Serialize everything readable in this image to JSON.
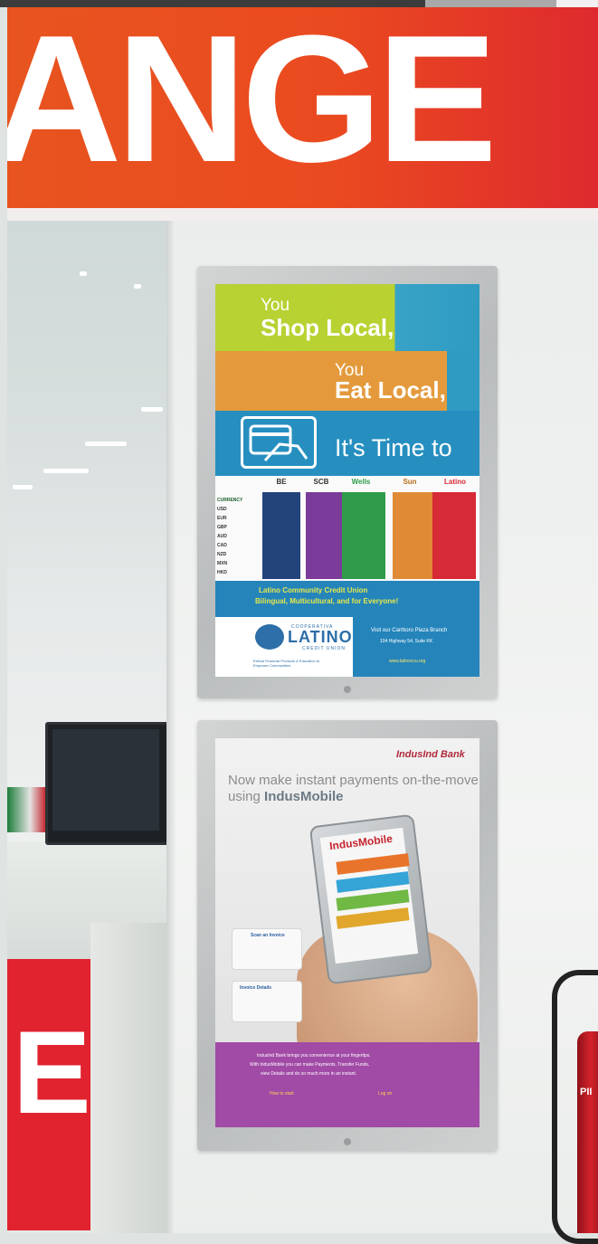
{
  "banner": {
    "text": "ANGE"
  },
  "store": {
    "sign_letter": "E"
  },
  "poster_top": {
    "line1": "You",
    "line2": "Shop Local,",
    "line3": "You",
    "line4": "Eat Local,",
    "line5": "It's Time to",
    "currency_header": "CURRENCY",
    "currencies": [
      "USD",
      "EUR",
      "GBP",
      "AUD",
      "CAD",
      "NZD",
      "MXN",
      "HKD"
    ],
    "logos": [
      "BE",
      "SCB",
      "Wells",
      "Sun",
      "Latino"
    ],
    "tagline1": "Latino Community Credit Union",
    "tagline2": "Bilingual, Multicultural, and for Everyone!",
    "logo": "LATINO",
    "logo_top": "COOPERATIVA",
    "logo_sub": "CREDIT UNION",
    "visit": "Visit our Carrboro Plaza Branch",
    "address": "104 Highway 54, Suite KK",
    "url": "www.latinoccu.org",
    "fine_print": "Ethical Financial Products & Education to Empower Communities"
  },
  "poster_bottom": {
    "brand": "IndusInd Bank",
    "headline1": "Now make instant payments on-the-move",
    "headline2_prefix": "using",
    "headline2_bold": "IndusMobile",
    "app_logo": "IndusMobile",
    "callout1_title": "Scan an Invoice",
    "callout2_title": "Invoice Details",
    "band_line1": "IndusInd Bank brings you convenience at your fingertips.",
    "band_line2": "With IndusMobile you can make Payments, Transfer Funds,",
    "band_line3": "view Details and do so much more in an instant.",
    "band_left_title": "How to start",
    "band_right_title": "Log on"
  },
  "extinguisher": {
    "label": "PII"
  },
  "colors": {
    "banner": "#e8541f",
    "banner_end": "#de2a2e",
    "lime": "#b8d133",
    "orange": "#e49a3c",
    "blue": "#268fc0",
    "purple_band": "#a14aa6",
    "red_sign": "#e1222f"
  }
}
